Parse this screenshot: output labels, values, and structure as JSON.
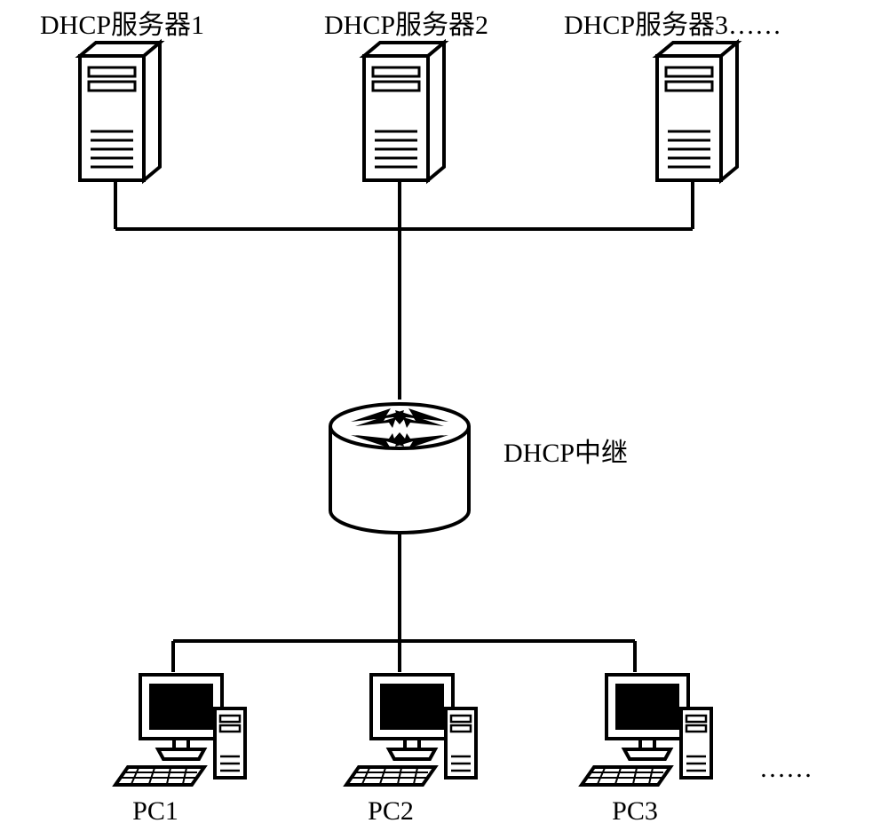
{
  "servers": [
    {
      "label": "DHCP服务器1"
    },
    {
      "label": "DHCP服务器2"
    },
    {
      "label": "DHCP服务器3……"
    }
  ],
  "relay": {
    "label": "DHCP中继"
  },
  "clients": [
    {
      "label": "PC1"
    },
    {
      "label": "PC2"
    },
    {
      "label": "PC3"
    }
  ],
  "client_ellipsis": "……"
}
